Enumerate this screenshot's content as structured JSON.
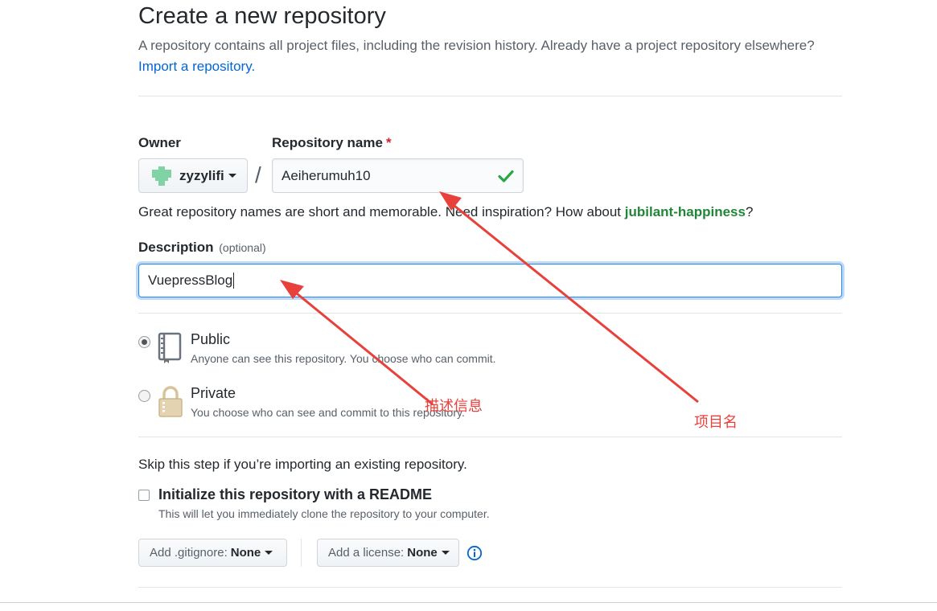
{
  "page": {
    "title": "Create a new repository",
    "subtitle": "A repository contains all project files, including the revision history. Already have a project repository elsewhere?",
    "import_link": "Import a repository."
  },
  "owner": {
    "label": "Owner",
    "value": "zyzylifi"
  },
  "repo_name": {
    "label": "Repository name",
    "required_mark": "*",
    "value": "Aeiherumuh10",
    "separator": "/"
  },
  "hint": {
    "prefix": "Great repository names are short and memorable. Need inspiration? How about ",
    "suggestion": "jubilant-happiness",
    "suffix": "?"
  },
  "description": {
    "label": "Description",
    "optional": "(optional)",
    "value": "VuepressBlog"
  },
  "visibility": {
    "public": {
      "title": "Public",
      "note": "Anyone can see this repository. You choose who can commit.",
      "selected": true
    },
    "private": {
      "title": "Private",
      "note": "You choose who can see and commit to this repository.",
      "selected": false
    }
  },
  "init": {
    "skip_text": "Skip this step if you’re importing an existing repository.",
    "readme_title": "Initialize this repository with a README",
    "readme_note": "This will let you immediately clone the repository to your computer.",
    "readme_checked": false
  },
  "options": {
    "gitignore_label": "Add .gitignore:",
    "gitignore_value": "None",
    "license_label": "Add a license:",
    "license_value": "None"
  },
  "annotations": {
    "description_note": "描述信息",
    "repo_name_note": "项目名",
    "color": "#e8413c"
  },
  "colors": {
    "link": "#0366d6",
    "suggestion": "#22863a",
    "required": "#cb2431",
    "check": "#28a745",
    "focus": "#2188ff"
  }
}
